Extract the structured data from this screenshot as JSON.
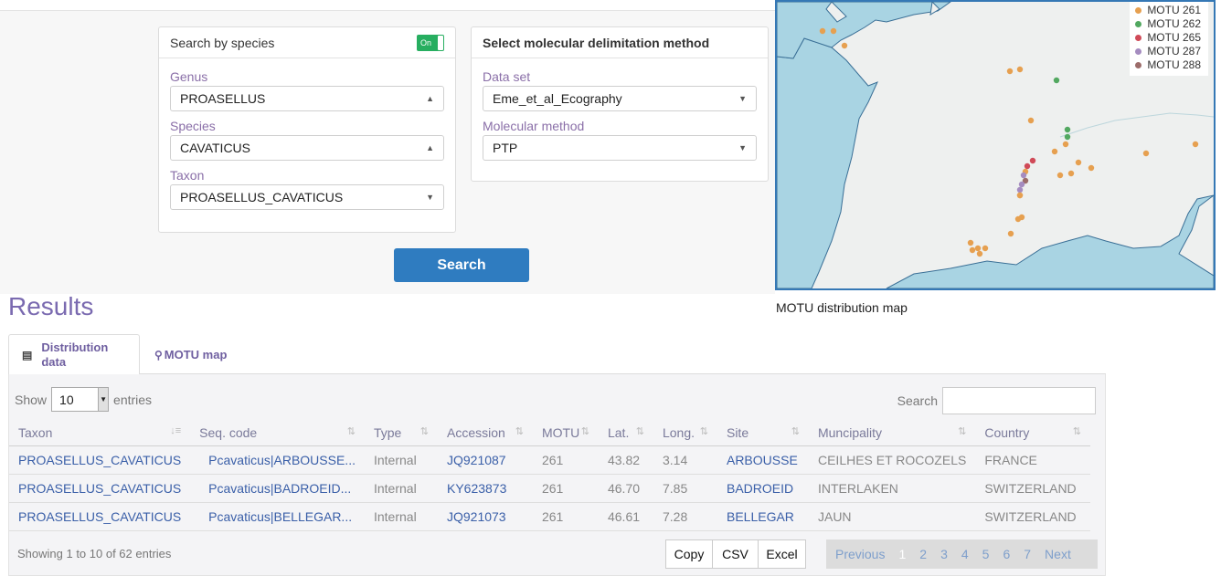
{
  "search_panel": {
    "title": "Search by species",
    "toggle_label": "On",
    "genus_label": "Genus",
    "genus_value": "PROASELLUS",
    "species_label": "Species",
    "species_value": "CAVATICUS",
    "taxon_label": "Taxon",
    "taxon_value": "PROASELLUS_CAVATICUS"
  },
  "method_panel": {
    "title": "Select molecular delimitation method",
    "dataset_label": "Data set",
    "dataset_value": "Eme_et_al_Ecography",
    "method_label": "Molecular method",
    "method_value": "PTP"
  },
  "search_button": "Search",
  "map": {
    "caption": "MOTU distribution map",
    "legend": [
      {
        "label": "MOTU 261",
        "color": "#e6a050"
      },
      {
        "label": "MOTU 262",
        "color": "#52a860"
      },
      {
        "label": "MOTU 265",
        "color": "#d04a58"
      },
      {
        "label": "MOTU 287",
        "color": "#a58cc0"
      },
      {
        "label": "MOTU 288",
        "color": "#9c6c6a"
      }
    ],
    "colors": {
      "water": "#a9d4e3",
      "land": "#eef0ef",
      "border": "#3a6f96"
    }
  },
  "results": {
    "title": "Results",
    "tabs": {
      "distribution_line1": "Distribution",
      "distribution_line2": "data",
      "distribution_icon": "table-icon",
      "motu_map": "MOTU map",
      "motu_icon": "map-marker-icon"
    },
    "show_label": "Show",
    "entries_value": "10",
    "entries_label": "entries",
    "search_label": "Search",
    "columns": [
      "Taxon",
      "Seq. code",
      "Type",
      "Accession",
      "MOTU",
      "Lat.",
      "Long.",
      "Site",
      "Muncipality",
      "Country"
    ],
    "rows": [
      [
        "PROASELLUS_CAVATICUS",
        "Pcavaticus|ARBOUSSE...",
        "Internal",
        "JQ921087",
        "261",
        "43.82",
        "3.14",
        "ARBOUSSE",
        "CEILHES ET ROCOZELS",
        "FRANCE"
      ],
      [
        "PROASELLUS_CAVATICUS",
        "Pcavaticus|BADROEID...",
        "Internal",
        "KY623873",
        "261",
        "46.70",
        "7.85",
        "BADROEID",
        "INTERLAKEN",
        "SWITZERLAND"
      ],
      [
        "PROASELLUS_CAVATICUS",
        "Pcavaticus|BELLEGAR...",
        "Internal",
        "JQ921073",
        "261",
        "46.61",
        "7.28",
        "BELLEGAR",
        "JAUN",
        "SWITZERLAND"
      ]
    ],
    "info": "Showing 1 to 10 of 62 entries",
    "export": {
      "copy": "Copy",
      "csv": "CSV",
      "excel": "Excel"
    },
    "pager": {
      "previous": "Previous",
      "current": "1",
      "pages": [
        "2",
        "3",
        "4",
        "5",
        "6",
        "7"
      ],
      "next": "Next"
    }
  }
}
